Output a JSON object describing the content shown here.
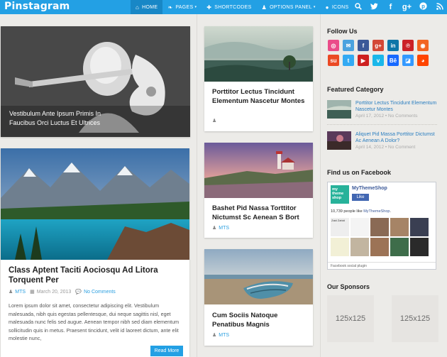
{
  "header": {
    "logo": "Pinstagram",
    "nav": [
      {
        "label": "HOME",
        "icon": "⌂"
      },
      {
        "label": "PAGES",
        "icon": "❧",
        "caret": "▾"
      },
      {
        "label": "SHORTCODES",
        "icon": "✚"
      },
      {
        "label": "OPTIONS PANEL",
        "icon": "♟",
        "caret": "▾"
      },
      {
        "label": "ICONS",
        "icon": "●"
      }
    ],
    "icons": {
      "search": "⚲",
      "twitter": "🐦",
      "facebook": "f",
      "googleplus": "g+",
      "pinterest": "℗",
      "rss": "◉"
    }
  },
  "posts": {
    "slider": {
      "caption": "Vestibulum Ante Ipsum Primis In Faucibus Orci Luctus Et Ultrices"
    },
    "featured": {
      "title": "Class Aptent Taciti Aociosqu Ad Litora Torquent Per",
      "author": "MTS",
      "date": "March 20, 2013",
      "comments": "No Comments",
      "excerpt": "Lorem ipsum dolor sit amet, consectetur adipiscing elit. Vestibulum malesuada, nibh quis egestas pellentesque, dui neque sagittis nisl, eget malesuada nunc felis sed augue. Aenean tempor nibh sed diam elementum sollicitudin quis in metus. Praesent tincidunt, velit id laoreet dictum, ante elit molestie nunc,",
      "read_more": "Read More"
    },
    "grid": [
      {
        "title": "Porttitor Lectus Tincidunt Elementum Nascetur Montes",
        "author": ""
      },
      {
        "title": "Bashet Pid Nassa Torttitor Nictumst Sc Aenean S Bort",
        "author": "MTS"
      },
      {
        "title": "Cum Sociis Natoque Penatibus Magnis",
        "author": "MTS"
      }
    ]
  },
  "sidebar": {
    "follow_us": "Follow Us",
    "social": [
      {
        "name": "dribbble-icon",
        "bg": "#ea4c89",
        "glyph": "◎"
      },
      {
        "name": "email-icon",
        "bg": "#4aa3df",
        "glyph": "✉"
      },
      {
        "name": "facebook-icon",
        "bg": "#3b5998",
        "glyph": "f"
      },
      {
        "name": "googleplus-icon",
        "bg": "#d34836",
        "glyph": "g+"
      },
      {
        "name": "linkedin-icon",
        "bg": "#0e76a8",
        "glyph": "in"
      },
      {
        "name": "pinterest-icon",
        "bg": "#cb2027",
        "glyph": "℗"
      },
      {
        "name": "rss-icon",
        "bg": "#f26522",
        "glyph": "◉"
      },
      {
        "name": "stumbleupon-icon",
        "bg": "#eb4924",
        "glyph": "su"
      },
      {
        "name": "twitter-icon",
        "bg": "#33aaf3",
        "glyph": "t"
      },
      {
        "name": "youtube-icon",
        "bg": "#cd201f",
        "glyph": "▶"
      },
      {
        "name": "vimeo-icon",
        "bg": "#1ab7ea",
        "glyph": "v"
      },
      {
        "name": "behance-icon",
        "bg": "#1769ff",
        "glyph": "Bē"
      },
      {
        "name": "delicious-icon",
        "bg": "#3399ff",
        "glyph": "◪"
      },
      {
        "name": "reddit-icon",
        "bg": "#ff4500",
        "glyph": "◕"
      }
    ],
    "featured_category": "Featured Category",
    "featured_items": [
      {
        "title": "Porttitor Lectus Tincidunt Elementum Nascetur Montes",
        "date": "April 17, 2012",
        "comments": "No Comments"
      },
      {
        "title": "Aliquet Pid Massa Porttitor Dictumst Ac Aenean A Dolor?",
        "date": "April 14, 2012",
        "comments": "No Comment"
      }
    ],
    "facebook": {
      "heading": "Find us on Facebook",
      "page_name": "MyThemeShop",
      "like": "Like",
      "likes_text": "10,739 people like",
      "likes_link": "MyThemeShop",
      "fan_first": "Zaid Zahid",
      "plugin": "Facebook social plugin"
    },
    "sponsors_heading": "Our Sponsors",
    "sponsors": [
      "125x125",
      "125x125"
    ]
  }
}
